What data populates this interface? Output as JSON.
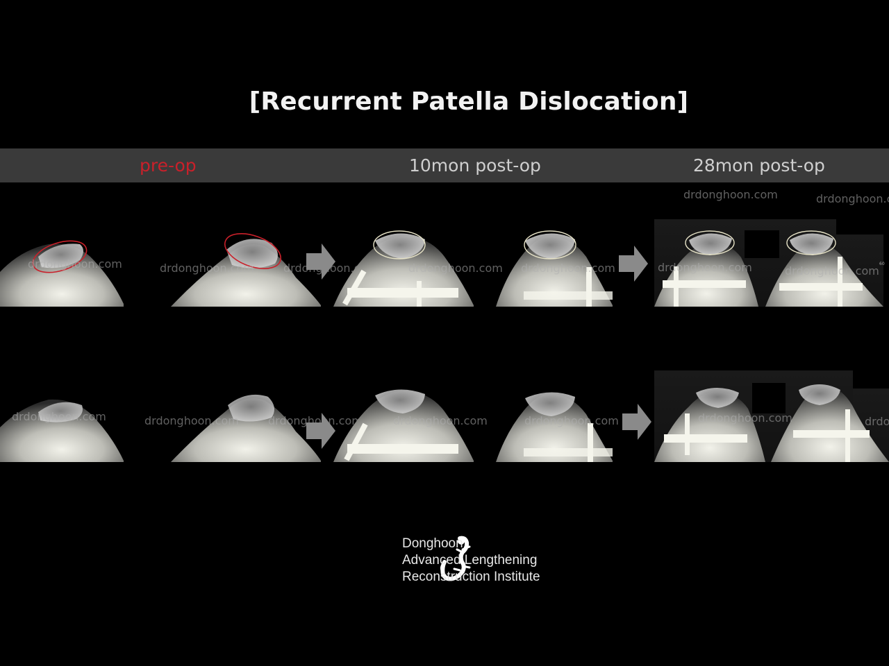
{
  "title": "[Recurrent Patella Dislocation]",
  "labels": {
    "pre": "pre-op",
    "mid": "10mon post-op",
    "late": "28mon post-op"
  },
  "watermark": "drdonghoon.com",
  "marker": "60",
  "logo": {
    "line1": "Donghoon",
    "line2": "Advanced Lengthening",
    "line3": "Reconstruction Institute"
  },
  "colors": {
    "accent_red": "#c9202a",
    "band": "#3a3a3a",
    "ellipse_post": "#e8e4c8"
  },
  "icons": [
    "right-arrow-icon",
    "gecko-logo-icon"
  ]
}
